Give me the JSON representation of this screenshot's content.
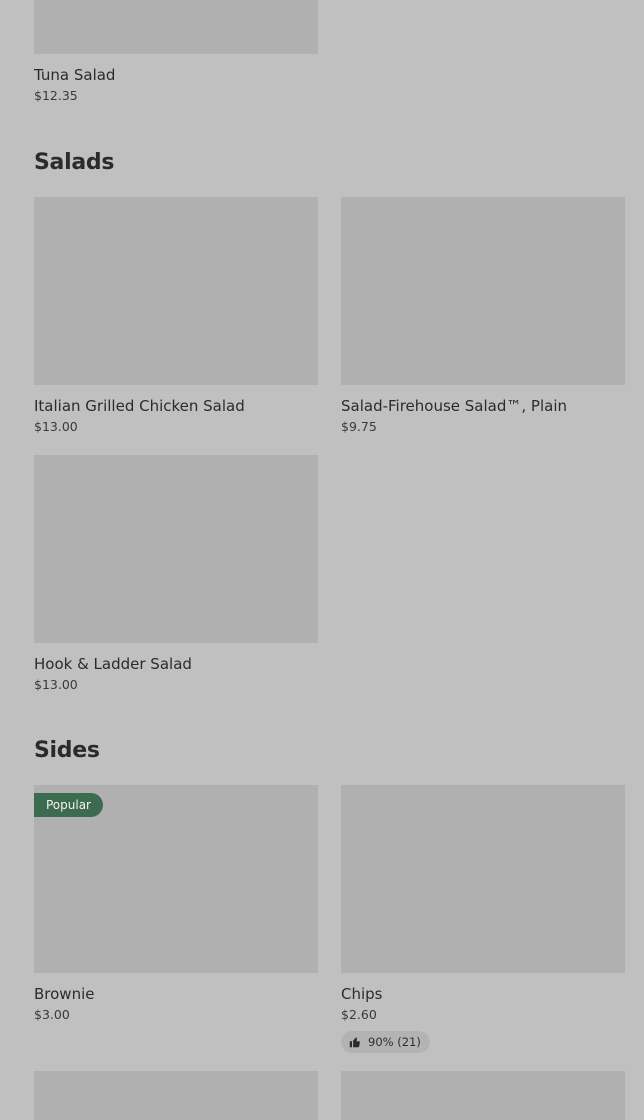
{
  "sections": {
    "salads": {
      "title": "Salads"
    },
    "sides": {
      "title": "Sides"
    }
  },
  "items": {
    "tuna_salad": {
      "name": "Tuna Salad",
      "price": "$12.35"
    },
    "italian_grilled_chicken_salad": {
      "name": "Italian Grilled Chicken Salad",
      "price": "$13.00"
    },
    "firehouse_salad_plain": {
      "name": "Salad-Firehouse Salad™, Plain",
      "price": "$9.75"
    },
    "hook_ladder_salad": {
      "name": "Hook & Ladder Salad",
      "price": "$13.00"
    },
    "brownie": {
      "name": "Brownie",
      "price": "$3.00",
      "badge": "Popular"
    },
    "chips": {
      "name": "Chips",
      "price": "$2.60",
      "rating": "90% (21)"
    }
  },
  "colors": {
    "background": "#c0c0c0",
    "image_placeholder": "#b0b0b0",
    "popular_badge": "#3d6b50"
  },
  "icons": {
    "rating": "thumbs-up-icon"
  }
}
